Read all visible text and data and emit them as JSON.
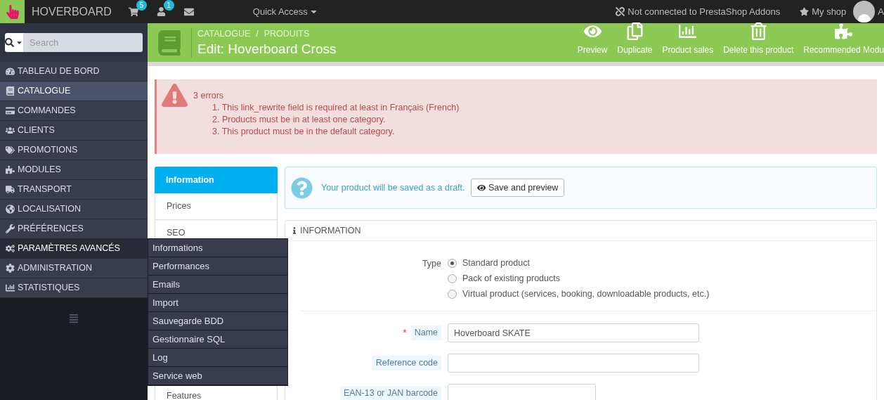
{
  "topbar": {
    "shop_name": "HOVERBOARD",
    "cart_badge": "5",
    "customers_badge": "1",
    "quick_access": "Quick Access",
    "addons_status": "Not connected to PrestaShop Addons",
    "my_shop": "My shop",
    "user_name": "A"
  },
  "search": {
    "placeholder": "Search"
  },
  "sidebar": {
    "items": [
      {
        "label": "TABLEAU DE BORD",
        "selected": false,
        "expanded": false
      },
      {
        "label": "CATALOGUE",
        "selected": true,
        "expanded": false
      },
      {
        "label": "COMMANDES",
        "selected": false,
        "expanded": false
      },
      {
        "label": "CLIENTS",
        "selected": false,
        "expanded": false
      },
      {
        "label": "PROMOTIONS",
        "selected": false,
        "expanded": false
      },
      {
        "label": "MODULES",
        "selected": false,
        "expanded": false
      },
      {
        "label": "TRANSPORT",
        "selected": false,
        "expanded": false
      },
      {
        "label": "LOCALISATION",
        "selected": false,
        "expanded": false
      },
      {
        "label": "PRÉFÉRENCES",
        "selected": false,
        "expanded": false
      },
      {
        "label": "PARAMÈTRES AVANCÉS",
        "selected": false,
        "expanded": true,
        "children": [
          "Informations",
          "Performances",
          "Emails",
          "Import",
          "Sauvegarde BDD",
          "Gestionnaire SQL",
          "Log",
          "Service web"
        ]
      },
      {
        "label": "ADMINISTRATION",
        "selected": false,
        "expanded": false
      },
      {
        "label": "STATISTIQUES",
        "selected": false,
        "expanded": false
      }
    ]
  },
  "header": {
    "breadcrumb": [
      "CATALOGUE",
      "PRODUITS"
    ],
    "separator": "/",
    "title": "Edit: Hoverboard Cross",
    "actions": [
      "Preview",
      "Duplicate",
      "Product sales",
      "Delete this product",
      "Recommended Modu"
    ]
  },
  "errors": {
    "title": "3 errors",
    "items": [
      "1. This link_rewrite field is required at least in Français (French)",
      "2. Products must be in at least one category.",
      "3. This product must be in the default category."
    ]
  },
  "tabs": [
    {
      "label": "Information",
      "selected": true
    },
    {
      "label": "Prices",
      "selected": false
    },
    {
      "label": "SEO",
      "selected": false
    },
    {
      "label": "Features",
      "selected": false
    }
  ],
  "draft_notice": {
    "text": "Your product will be saved as a draft.",
    "button": "Save and preview"
  },
  "panel": {
    "title": "INFORMATION",
    "type_label": "Type",
    "types": [
      {
        "label": "Standard product",
        "selected": true
      },
      {
        "label": "Pack of existing products",
        "selected": false
      },
      {
        "label": "Virtual product (services, booking, downloadable products, etc.)",
        "selected": false
      }
    ],
    "fields": [
      {
        "label": "Name",
        "required_mark": "*",
        "value": "Hoverboard SKATE"
      },
      {
        "label": "Reference code"
      },
      {
        "label": "EAN-13 or JAN barcode"
      }
    ]
  }
}
